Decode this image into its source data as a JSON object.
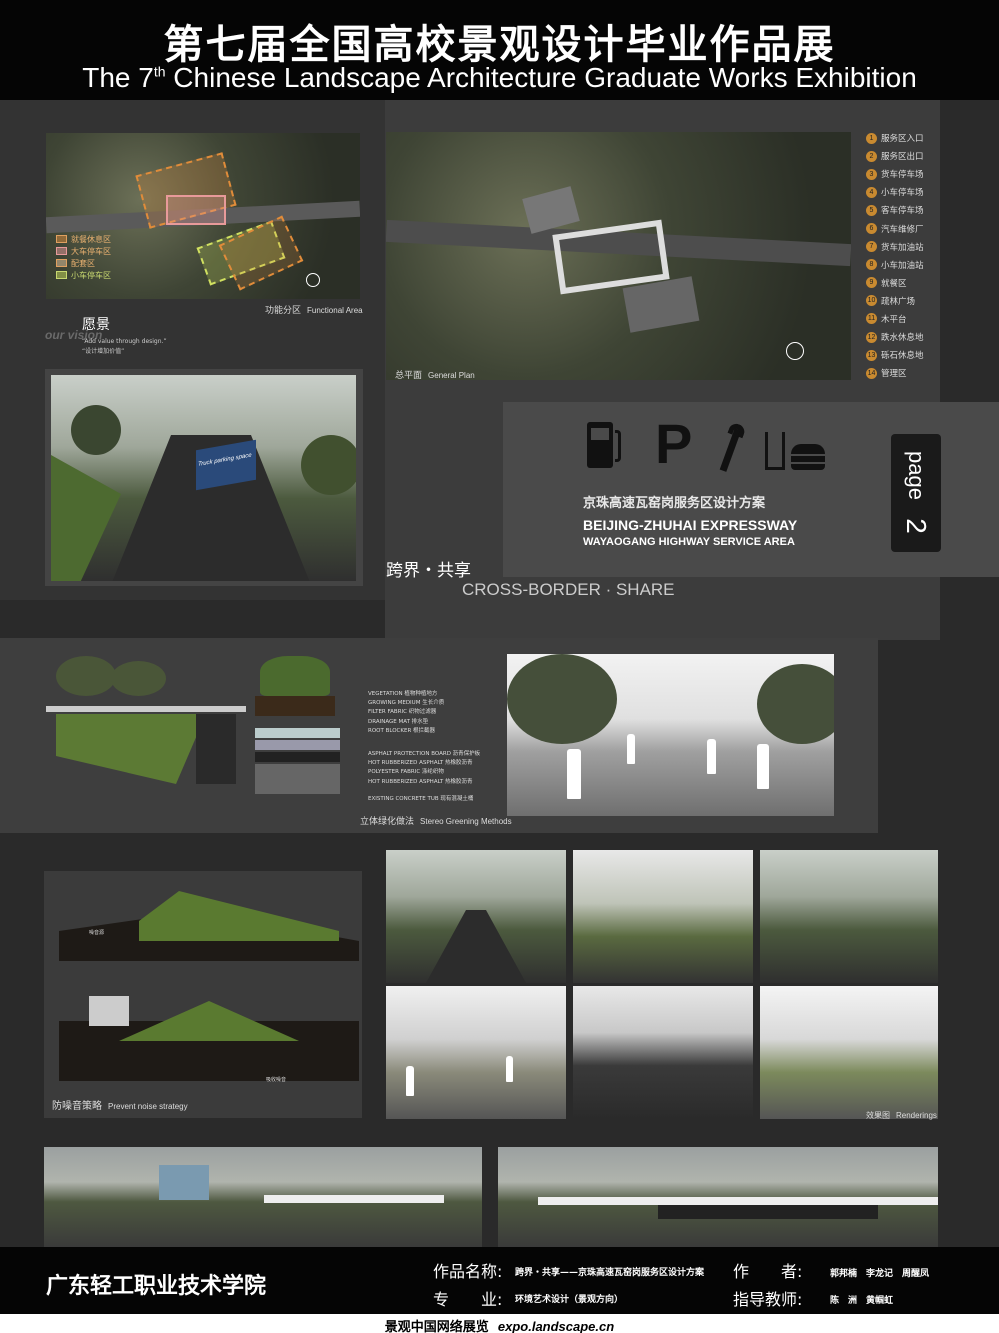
{
  "header": {
    "title_cn": "第七届全国高校景观设计毕业作品展",
    "title_en_pre": "The 7",
    "title_en_sup": "th",
    "title_en_post": " Chinese Landscape Architecture Graduate Works Exhibition"
  },
  "functional_area": {
    "legend": [
      "就餐休息区",
      "大车停车区",
      "配套区",
      "小车停车区"
    ],
    "caption_cn": "功能分区",
    "caption_en": "Functional Area"
  },
  "vision": {
    "title_cn": "愿景",
    "title_en": "our vision",
    "sub_en": "“Add value through design.”",
    "sub_cn": "“设计增加价值”"
  },
  "general_plan": {
    "caption_cn": "总平面",
    "caption_en": "General Plan",
    "items": [
      {
        "num": "1",
        "label": "服务区入口"
      },
      {
        "num": "2",
        "label": "服务区出口"
      },
      {
        "num": "3",
        "label": "货车停车场"
      },
      {
        "num": "4",
        "label": "小车停车场"
      },
      {
        "num": "5",
        "label": "客车停车场"
      },
      {
        "num": "6",
        "label": "汽车维修厂"
      },
      {
        "num": "7",
        "label": "货车加油站"
      },
      {
        "num": "8",
        "label": "小车加油站"
      },
      {
        "num": "9",
        "label": "就餐区"
      },
      {
        "num": "10",
        "label": "疏林广场"
      },
      {
        "num": "11",
        "label": "木平台"
      },
      {
        "num": "12",
        "label": "跌水休息地"
      },
      {
        "num": "13",
        "label": "砾石休息地"
      },
      {
        "num": "14",
        "label": "管理区"
      }
    ]
  },
  "rendering_truck": {
    "sign": "Truck parking space"
  },
  "title_card": {
    "title_cn": "京珠高速瓦窑岗服务区设计方案",
    "title_en_1": "BEIJING-ZHUHAI  EXPRESSWAY",
    "title_en_2": "WAYAOGANG  HIGHWAY SERVICE  AREA",
    "page_word": "page",
    "page_num": "2",
    "parking_letter": "P"
  },
  "theme": {
    "cn": "跨界・共享",
    "en": "CROSS-BORDER · SHARE"
  },
  "stereo_greening": {
    "caption_cn": "立体绿化做法",
    "caption_en": "Stereo Greening Methods",
    "layers": [
      "VEGETATION 植物种植地方",
      "GROWING MEDIUM 生长介质",
      "FILTER FABRIC 织物过滤器",
      "DRAINAGE MAT 排水垫",
      "ROOT BLOCKER 根拦截器",
      "ASPHALT PROTECTION BOARD 沥青保护板",
      "HOT RUBBERIZED ASPHALT 热橡胶沥青",
      "POLYESTER FABRIC 涤纶织物",
      "HOT RUBBERIZED ASPHALT 热橡胶沥青",
      "EXISTING CONCRETE TUB 现有混凝土桶"
    ]
  },
  "noise": {
    "caption_cn": "防噪音策略",
    "caption_en": "Prevent noise strategy",
    "label_1": "噪音源",
    "label_2": "吸收噪音"
  },
  "renderings": {
    "caption_cn": "效果图",
    "caption_en": "Renderings"
  },
  "footer": {
    "school": "广东轻工职业技术学院",
    "work_label": "作品名称:",
    "work_value": "跨界・共享——京珠高速瓦窑岗服务区设计方案",
    "author_label": "作　　者:",
    "author_value": "郭邦楠　李龙记　周醒凤",
    "major_label": "专　　业:",
    "major_value": "环境艺术设计（景观方向）",
    "advisor_label": "指导教师:",
    "advisor_value": "陈　洲　黄帼虹",
    "source_cn": "景观中国网络展览",
    "source_url": "expo.landscape.cn"
  }
}
